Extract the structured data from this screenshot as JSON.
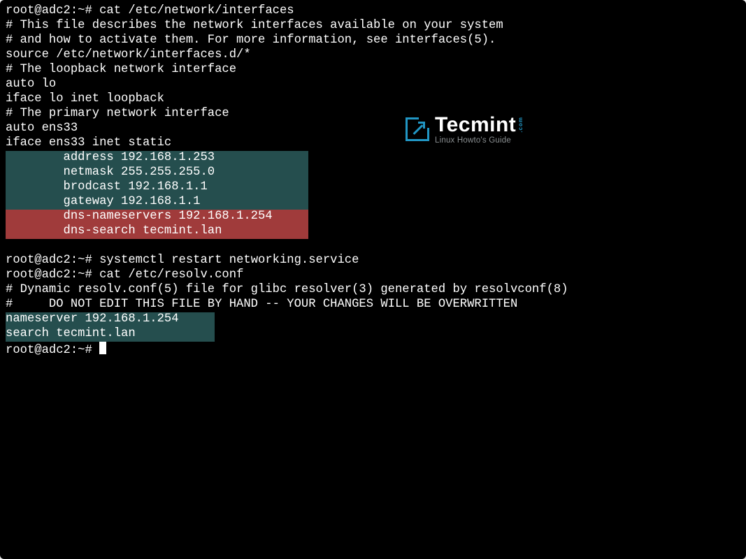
{
  "prompt1": "root@adc2:~# ",
  "cmd1": "cat /etc/network/interfaces",
  "file_interfaces": {
    "l1": "# This file describes the network interfaces available on your system",
    "l2": "# and how to activate them. For more information, see interfaces(5).",
    "l3": "",
    "l4": "source /etc/network/interfaces.d/*",
    "l5": "",
    "l6": "# The loopback network interface",
    "l7": "auto lo",
    "l8": "iface lo inet loopback",
    "l9": "",
    "l10": "# The primary network interface",
    "l11": "auto ens33",
    "l12": "iface ens33 inet static",
    "hl_teal": {
      "a": "        address 192.168.1.253             ",
      "b": "        netmask 255.255.255.0             ",
      "c": "        brodcast 192.168.1.1              ",
      "d": "        gateway 192.168.1.1               "
    },
    "hl_red": {
      "a": "        dns-nameservers 192.168.1.254     ",
      "b": "        dns-search tecmint.lan            "
    }
  },
  "cmd2": "systemctl restart networking.service",
  "cmd3": "cat /etc/resolv.conf",
  "file_resolv": {
    "l1": "# Dynamic resolv.conf(5) file for glibc resolver(3) generated by resolvconf(8)",
    "l2": "#     DO NOT EDIT THIS FILE BY HAND -- YOUR CHANGES WILL BE OVERWRITTEN",
    "hl_teal": {
      "a": "nameserver 192.168.1.254     ",
      "b": "search tecmint.lan           "
    }
  },
  "spacer": " ",
  "logo": {
    "brand": "Tecmint",
    "domain": ".com",
    "sub": "Linux Howto's Guide"
  }
}
